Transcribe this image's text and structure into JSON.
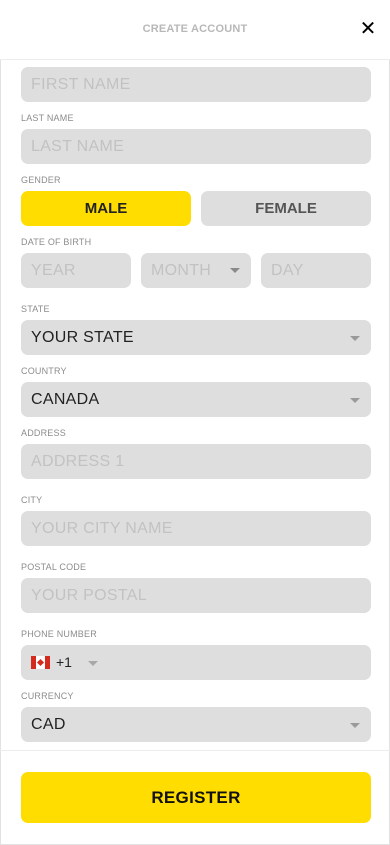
{
  "header": {
    "title": "CREATE ACCOUNT",
    "close_label": "✕"
  },
  "form": {
    "first_name": {
      "placeholder": "FIRST NAME"
    },
    "last_name": {
      "label": "LAST NAME",
      "placeholder": "LAST NAME"
    },
    "gender": {
      "label": "GENDER",
      "options": [
        "MALE",
        "FEMALE"
      ],
      "selected": "MALE"
    },
    "date_of_birth": {
      "label": "DATE OF BIRTH",
      "year_placeholder": "YEAR",
      "month_placeholder": "MONTH",
      "day_placeholder": "DAY"
    },
    "state": {
      "label": "STATE",
      "value": "YOUR STATE"
    },
    "country": {
      "label": "COUNTRY",
      "value": "CANADA"
    },
    "address": {
      "label": "ADDRESS",
      "placeholder": "ADDRESS 1"
    },
    "city": {
      "label": "CITY",
      "placeholder": "YOUR CITY NAME"
    },
    "postal_code": {
      "label": "POSTAL CODE",
      "placeholder": "YOUR POSTAL"
    },
    "phone": {
      "label": "PHONE NUMBER",
      "flag": "canada-flag-icon",
      "dial_code": "+1"
    },
    "currency": {
      "label": "CURRENCY",
      "value": "CAD"
    }
  },
  "footer": {
    "register_label": "REGISTER"
  },
  "colors": {
    "accent": "#ffdd00",
    "field_bg": "#dedede",
    "placeholder": "#c2c2c2"
  }
}
